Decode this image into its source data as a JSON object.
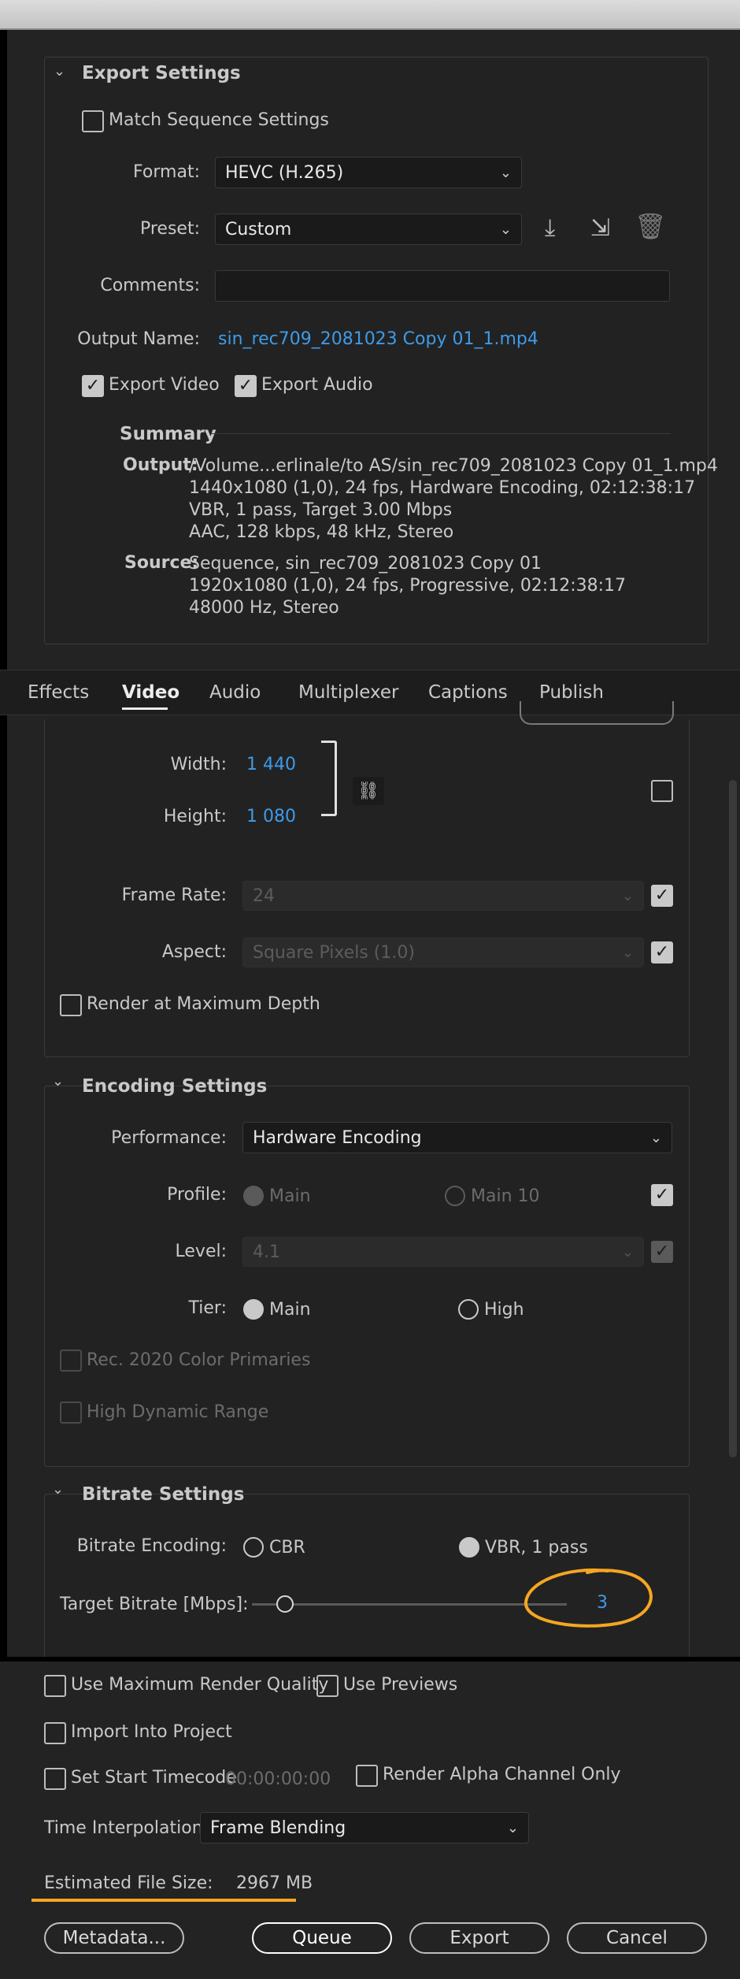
{
  "export_settings": {
    "title": "Export Settings",
    "match_sequence": "Match Sequence Settings",
    "format_label": "Format:",
    "format_value": "HEVC (H.265)",
    "preset_label": "Preset:",
    "preset_value": "Custom",
    "comments_label": "Comments:",
    "comments_value": "",
    "output_name_label": "Output Name:",
    "output_name_value": "sin_rec709_2081023 Copy 01_1.mp4",
    "export_video": "Export Video",
    "export_audio": "Export Audio"
  },
  "summary": {
    "title": "Summary",
    "output_label": "Output:",
    "output_lines": [
      "/Volume...erlinale/to AS/sin_rec709_2081023 Copy 01_1.mp4",
      "1440x1080 (1,0), 24 fps, Hardware Encoding, 02:12:38:17",
      "VBR, 1 pass, Target 3.00 Mbps",
      "AAC, 128 kbps, 48 kHz, Stereo"
    ],
    "source_label": "Source:",
    "source_lines": [
      "Sequence, sin_rec709_2081023 Copy 01",
      "1920x1080 (1,0), 24 fps, Progressive, 02:12:38:17",
      "48000 Hz, Stereo"
    ]
  },
  "tabs": [
    "Effects",
    "Video",
    "Audio",
    "Multiplexer",
    "Captions",
    "Publish"
  ],
  "video": {
    "width_label": "Width:",
    "width_value": "1 440",
    "height_label": "Height:",
    "height_value": "1 080",
    "frame_rate_label": "Frame Rate:",
    "frame_rate_value": "24",
    "aspect_label": "Aspect:",
    "aspect_value": "Square Pixels (1.0)",
    "render_max_depth": "Render at Maximum Depth"
  },
  "encoding": {
    "title": "Encoding Settings",
    "performance_label": "Performance:",
    "performance_value": "Hardware Encoding",
    "profile_label": "Profile:",
    "profile_main": "Main",
    "profile_main10": "Main 10",
    "level_label": "Level:",
    "level_value": "4.1",
    "tier_label": "Tier:",
    "tier_main": "Main",
    "tier_high": "High",
    "rec2020": "Rec. 2020 Color Primaries",
    "hdr": "High Dynamic Range"
  },
  "bitrate": {
    "title": "Bitrate Settings",
    "encoding_label": "Bitrate Encoding:",
    "cbr": "CBR",
    "vbr": "VBR, 1 pass",
    "target_label": "Target Bitrate [Mbps]:",
    "target_value": "3",
    "target_value_num": 3
  },
  "bottom": {
    "max_render_quality": "Use Maximum Render Quality",
    "use_previews": "Use Previews",
    "import_into_project": "Import Into Project",
    "set_start_timecode": "Set Start Timecode",
    "timecode_value": "00:00:00:00",
    "render_alpha": "Render Alpha Channel Only",
    "time_interp_label": "Time Interpolation:",
    "time_interp_value": "Frame Blending",
    "est_file_size_label": "Estimated File Size:",
    "est_file_size_value": "2967 MB",
    "metadata_btn": "Metadata...",
    "queue_btn": "Queue",
    "export_btn": "Export",
    "cancel_btn": "Cancel"
  },
  "colors": {
    "background": "#232323",
    "link_blue": "#3d9be9",
    "annotation_orange": "#f5a623"
  }
}
